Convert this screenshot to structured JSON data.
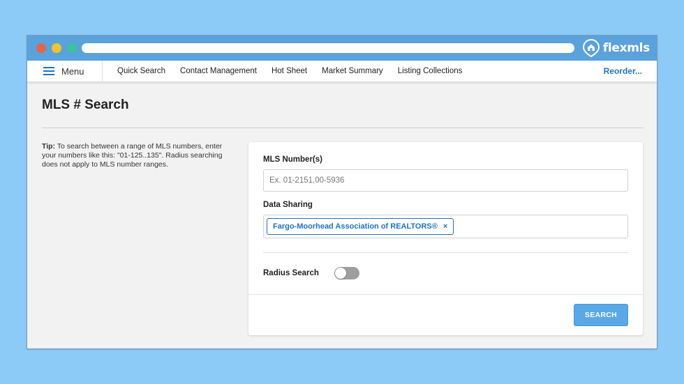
{
  "brand": {
    "name": "flexmls",
    "icon": "house-pin-icon"
  },
  "nav": {
    "menu_label": "Menu",
    "links": [
      "Quick Search",
      "Contact Management",
      "Hot Sheet",
      "Market Summary",
      "Listing Collections"
    ],
    "reorder_label": "Reorder..."
  },
  "page": {
    "title": "MLS # Search"
  },
  "tip": {
    "prefix": "Tip:",
    "text": "To search between a range of MLS numbers, enter your numbers like this: \"01-125..135\". Radius searching does not apply to MLS number ranges."
  },
  "form": {
    "mls_label": "MLS Number(s)",
    "mls_value": "",
    "mls_placeholder": "Ex. 01-2151,00-5936",
    "data_sharing_label": "Data Sharing",
    "data_sharing_chip": "Fargo-Moorhead Association of REALTORS®",
    "chip_remove": "×",
    "radius_label": "Radius Search",
    "radius_enabled": false,
    "search_label": "SEARCH"
  },
  "colors": {
    "background": "#8ccbf8",
    "titlebar": "#5aa2dc",
    "accent": "#1e73be",
    "button": "#5aa8e6"
  }
}
